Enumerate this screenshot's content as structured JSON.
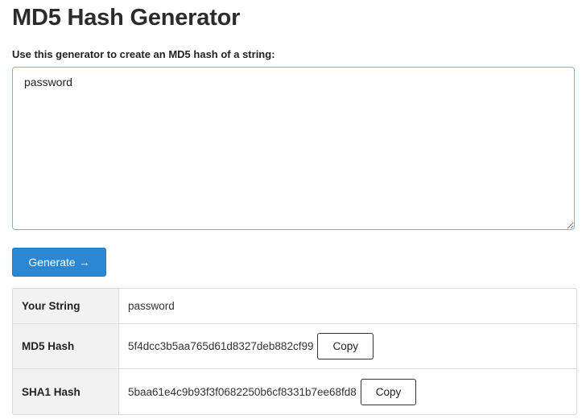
{
  "page": {
    "title": "MD5 Hash Generator",
    "instruction": "Use this generator to create an MD5 hash of a string:"
  },
  "input": {
    "value": "password"
  },
  "generate_button": {
    "label": "Generate",
    "icon": "arrow-right-icon",
    "color": "#2c87d2"
  },
  "results": {
    "rows": [
      {
        "label": "Your String",
        "value": "password"
      },
      {
        "label": "MD5 Hash",
        "value": "5f4dcc3b5aa765d61d8327deb882cf99",
        "copy_label": "Copy"
      },
      {
        "label": "SHA1 Hash",
        "value": "5baa61e4c9b93f3f0682250b6cf8331b7ee68fd8",
        "copy_label": "Copy"
      }
    ]
  }
}
